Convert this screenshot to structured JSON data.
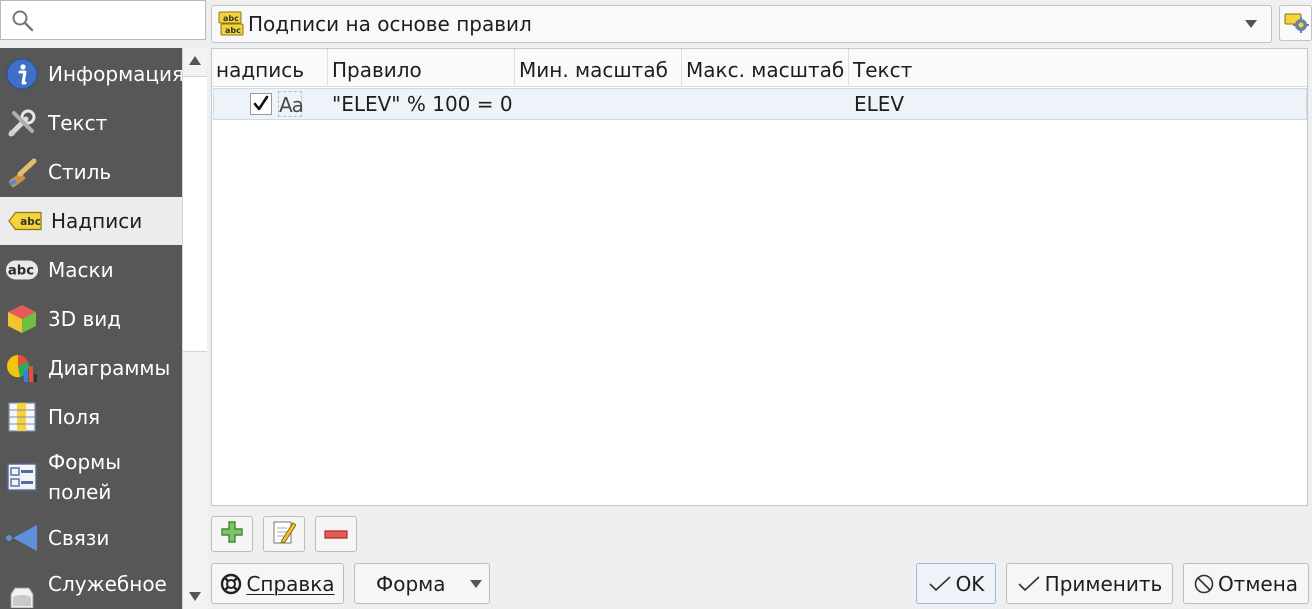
{
  "search": {
    "placeholder": ""
  },
  "sidebar": {
    "items": [
      {
        "label": "Информация",
        "icon": "info-icon",
        "active": false
      },
      {
        "label": "Текст",
        "icon": "text-tools-icon",
        "active": false
      },
      {
        "label": "Стиль",
        "icon": "paintbrush-icon",
        "active": false
      },
      {
        "label": "Надписи",
        "icon": "labels-abc-icon",
        "active": true
      },
      {
        "label": "Маски",
        "icon": "masks-abc-icon",
        "active": false
      },
      {
        "label": "3D вид",
        "icon": "cube-3d-icon",
        "active": false
      },
      {
        "label": "Диаграммы",
        "icon": "diagrams-icon",
        "active": false
      },
      {
        "label": "Поля",
        "icon": "fields-icon",
        "active": false
      },
      {
        "label": "Формы",
        "label_line2": "полей",
        "icon": "attributes-form-icon",
        "active": false
      },
      {
        "label": "Связи",
        "icon": "joins-icon",
        "active": false
      },
      {
        "label": "Служебное",
        "icon": "auxiliary-storage-icon",
        "active": false
      }
    ]
  },
  "mode": {
    "selected": "Подписи на основе правил",
    "icon": "rule-based-labels-icon"
  },
  "table": {
    "columns": [
      "надпись",
      "Правило",
      "Мин. масштаб",
      "Макс. масштаб",
      "Текст"
    ],
    "rows": [
      {
        "checked": true,
        "preview": "Aa",
        "rule": "\"ELEV\" % 100 = 0",
        "min_scale": "",
        "max_scale": "",
        "text": "ELEV"
      }
    ]
  },
  "tools": {
    "add": "add-rule-icon",
    "edit": "edit-rule-icon",
    "remove": "remove-rule-icon"
  },
  "buttons": {
    "help": "Справка",
    "style": "Форма",
    "ok": "OK",
    "apply": "Применить",
    "cancel": "Отмена"
  },
  "colors": {
    "sidebar_bg": "#575757",
    "active_item_bg": "#ececec",
    "selected_row": "#edf3f9"
  }
}
